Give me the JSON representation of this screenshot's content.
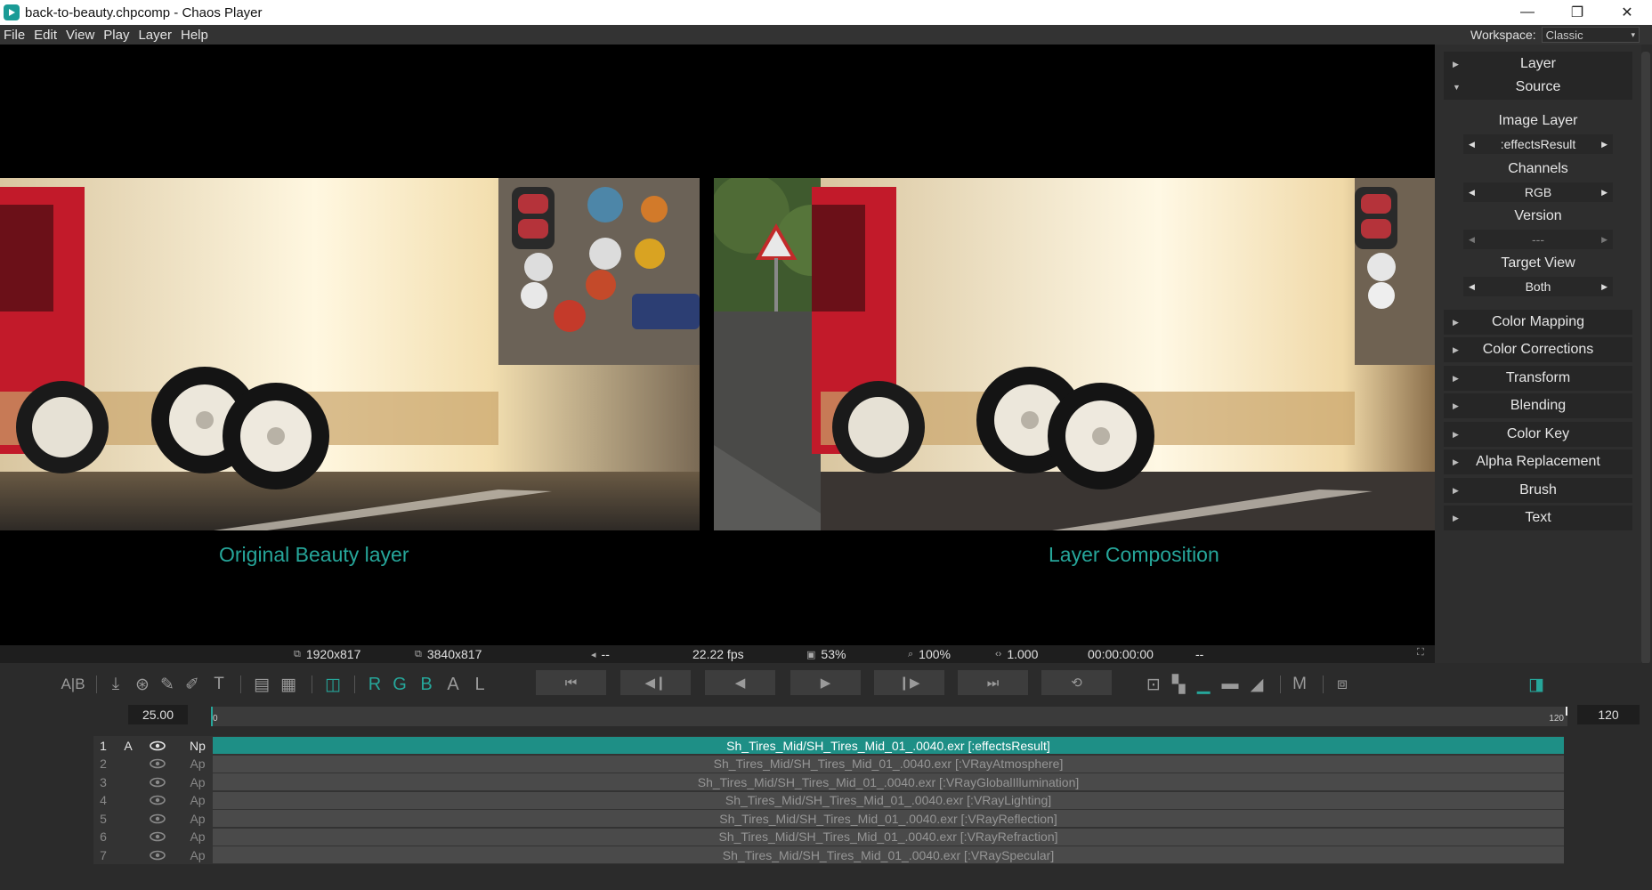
{
  "window": {
    "title": "back-to-beauty.chpcomp - Chaos Player",
    "minimize": "—",
    "maximize": "❐",
    "close": "✕"
  },
  "menu": [
    "File",
    "Edit",
    "View",
    "Play",
    "Layer",
    "Help"
  ],
  "workspace": {
    "label": "Workspace:",
    "value": "Classic"
  },
  "viewer": {
    "caption_left": "Original Beauty layer",
    "caption_right": "Layer Composition"
  },
  "status": {
    "res_a": "1920x817",
    "res_b": "3840x817",
    "audio": "--",
    "fps": "22.22 fps",
    "cpu": "53%",
    "zoom": "100%",
    "ratio": "1.000",
    "timecode": "00:00:00:00",
    "extra": "--"
  },
  "panel": {
    "section_layer": "Layer",
    "section_source": "Source",
    "image_layer_label": "Image Layer",
    "image_layer_value": ":effectsResult",
    "channels_label": "Channels",
    "channels_value": "RGB",
    "version_label": "Version",
    "version_value": "---",
    "target_view_label": "Target View",
    "target_view_value": "Both",
    "sections": [
      "Color Mapping",
      "Color Corrections",
      "Transform",
      "Blending",
      "Color Key",
      "Alpha Replacement",
      "Brush",
      "Text"
    ]
  },
  "toolbar": {
    "ab": "A|B",
    "channels": [
      "R",
      "G",
      "B",
      "A",
      "L"
    ],
    "m_label": "M"
  },
  "timeline": {
    "fps_value": "25.00",
    "end_frame": "120",
    "ruler_start": "0",
    "ruler_end": "120"
  },
  "layers": [
    {
      "num": "1",
      "a": "A",
      "mode": "Np",
      "name": "Sh_Tires_Mid/SH_Tires_Mid_01_.0040.exr [:effectsResult]",
      "active": true
    },
    {
      "num": "2",
      "a": "",
      "mode": "Ap",
      "name": "Sh_Tires_Mid/SH_Tires_Mid_01_.0040.exr [:VRayAtmosphere]",
      "active": false
    },
    {
      "num": "3",
      "a": "",
      "mode": "Ap",
      "name": "Sh_Tires_Mid/SH_Tires_Mid_01_.0040.exr [:VRayGlobalIllumination]",
      "active": false
    },
    {
      "num": "4",
      "a": "",
      "mode": "Ap",
      "name": "Sh_Tires_Mid/SH_Tires_Mid_01_.0040.exr [:VRayLighting]",
      "active": false
    },
    {
      "num": "5",
      "a": "",
      "mode": "Ap",
      "name": "Sh_Tires_Mid/SH_Tires_Mid_01_.0040.exr [:VRayReflection]",
      "active": false
    },
    {
      "num": "6",
      "a": "",
      "mode": "Ap",
      "name": "Sh_Tires_Mid/SH_Tires_Mid_01_.0040.exr [:VRayRefraction]",
      "active": false
    },
    {
      "num": "7",
      "a": "",
      "mode": "Ap",
      "name": "Sh_Tires_Mid/SH_Tires_Mid_01_.0040.exr [:VRaySpecular]",
      "active": false
    }
  ]
}
